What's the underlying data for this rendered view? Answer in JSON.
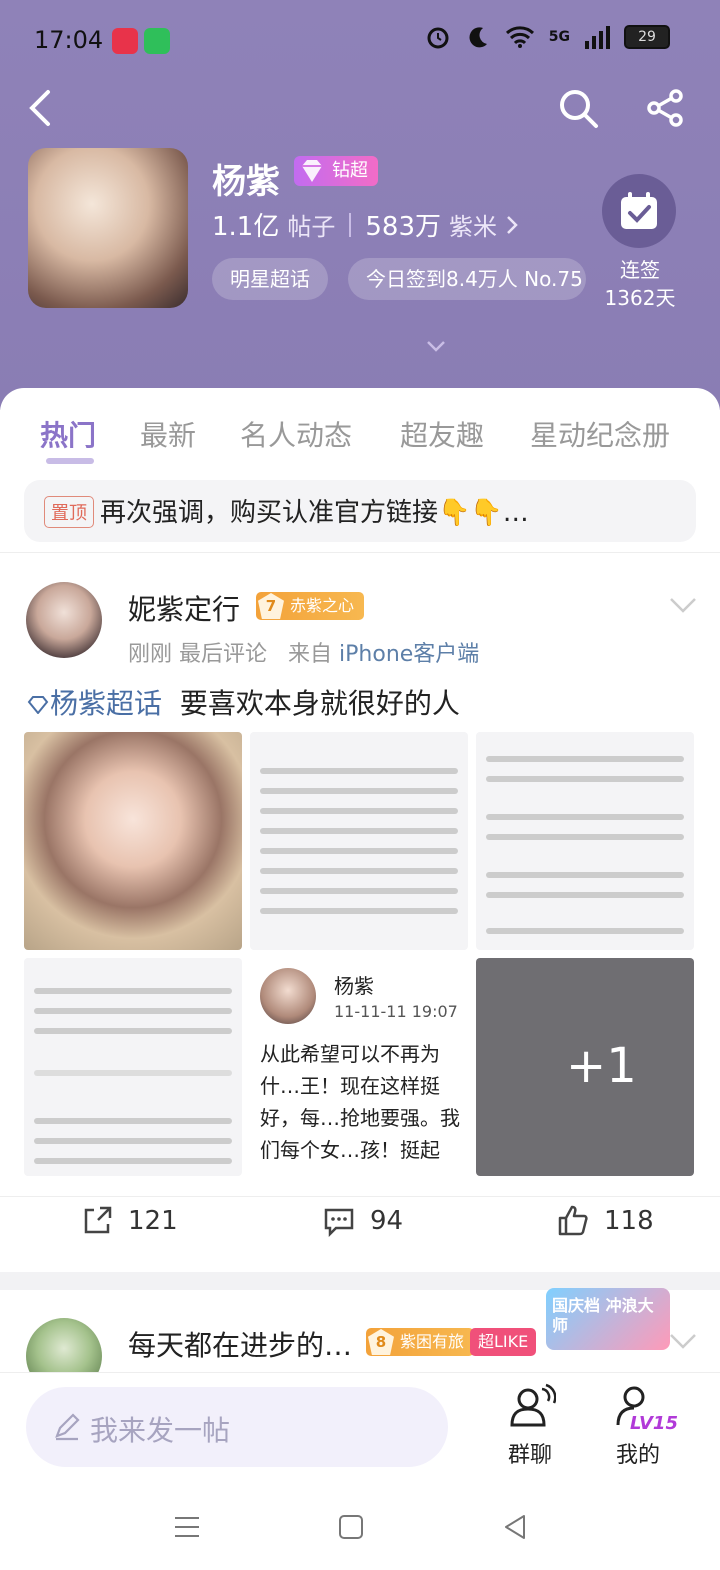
{
  "status_bar": {
    "time": "17:04",
    "network": "5G",
    "battery": "29"
  },
  "header": {
    "forum_name": "杨紫",
    "super_badge": "钻超",
    "posts_count": "1.1亿",
    "posts_label": "帖子",
    "fans_count": "583万",
    "fans_label": "紫米",
    "chip_category": "明星超话",
    "chip_checkin": "今日签到8.4万人 No.75",
    "checkin_label": "连签",
    "checkin_days": "1362天"
  },
  "tabs": [
    {
      "label": "热门"
    },
    {
      "label": "最新"
    },
    {
      "label": "名人动态"
    },
    {
      "label": "超友趣"
    },
    {
      "label": "星动纪念册"
    }
  ],
  "pinned": {
    "badge": "置顶",
    "text": "再次强调，购买认准官方链接👇👇…"
  },
  "post": {
    "author": "妮紫定行",
    "fan_level": "7",
    "fan_badge": "赤紫之心",
    "time": "刚刚",
    "last_comment": "最后评论",
    "source_prefix": "来自",
    "source": "iPhone客户端",
    "forum_tag": "杨紫超话",
    "text": "要喜欢本身就很好的人",
    "more_images": "+1",
    "quote_author": "杨紫",
    "quote_time": "11-11-11 19:07",
    "quote_text": "从此希望可以不再为什…王！现在这样挺好，每…抢地要强。我们每个女…孩！挺起背，骄傲的走…吧！",
    "shares": "121",
    "comments": "94",
    "likes": "118"
  },
  "post2": {
    "author": "每天都在进步的…",
    "fan_level": "8",
    "fan_badge": "紫困有旅",
    "like_badge": "超LIKE",
    "promo": "国庆档 冲浪大师"
  },
  "bottom": {
    "composer_placeholder": "我来发一帖",
    "group_chat": "群聊",
    "mine": "我的",
    "level": "LV15"
  }
}
